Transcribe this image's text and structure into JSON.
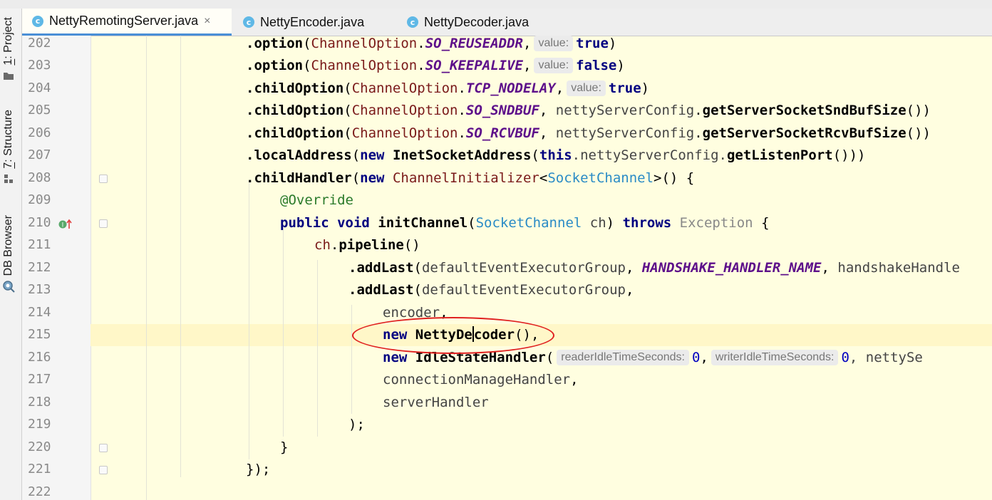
{
  "tool_windows": [
    {
      "number": "1",
      "label": "Project"
    },
    {
      "number": "7",
      "label": "Structure"
    },
    {
      "label": "DB Browser"
    }
  ],
  "editor_tabs": [
    {
      "label": "NettyRemotingServer.java",
      "active": true,
      "closable": true
    },
    {
      "label": "NettyEncoder.java",
      "active": false
    },
    {
      "label": "NettyDecoder.java",
      "active": false
    }
  ],
  "file_icon_letter": "c",
  "close_glyph": "×",
  "line_numbers": [
    "202",
    "203",
    "204",
    "205",
    "206",
    "207",
    "208",
    "209",
    "210",
    "211",
    "212",
    "213",
    "214",
    "215",
    "216",
    "217",
    "218",
    "219",
    "220",
    "221",
    "222"
  ],
  "code": {
    "l202": {
      "dot_option": ".option",
      "open": "(",
      "type": "ChannelOption",
      "dot": ".",
      "const": "SO_REUSEADDR",
      "comma": ",",
      "hint": "value:",
      "val": "true",
      "close": ")"
    },
    "l203": {
      "dot_option": ".option",
      "open": "(",
      "type": "ChannelOption",
      "dot": ".",
      "const": "SO_KEEPALIVE",
      "comma": ",",
      "hint": "value:",
      "val": "false",
      "close": ")"
    },
    "l204": {
      "dot_option": ".childOption",
      "open": "(",
      "type": "ChannelOption",
      "dot": ".",
      "const": "TCP_NODELAY",
      "comma": ",",
      "hint": "value:",
      "val": "true",
      "close": ")"
    },
    "l205": {
      "dot_option": ".childOption",
      "open": "(",
      "type": "ChannelOption",
      "dot": ".",
      "const": "SO_SNDBUF",
      "comma": ", ",
      "field": "nettyServerConfig",
      "dot2": ".",
      "call": "getServerSocketSndBufSize",
      "close": "())"
    },
    "l206": {
      "dot_option": ".childOption",
      "open": "(",
      "type": "ChannelOption",
      "dot": ".",
      "const": "SO_RCVBUF",
      "comma": ", ",
      "field": "nettyServerConfig",
      "dot2": ".",
      "call": "getServerSocketRcvBufSize",
      "close": "())"
    },
    "l207": {
      "call": ".localAddress",
      "open": "(",
      "kw_new": "new",
      "cls": "InetSocketAddress",
      "open2": "(",
      "kw_this": "this",
      "field": ".nettyServerConfig.",
      "call2": "getListenPort",
      "close": "()))"
    },
    "l208": {
      "call": ".childHandler",
      "open": "(",
      "kw_new": "new",
      "cls": "ChannelInitializer",
      "lt": "<",
      "tp": "SocketChannel",
      "rest": ">() {"
    },
    "l209": {
      "ann": "@Override"
    },
    "l210": {
      "kw1": "public",
      "kw2": "void",
      "name": "initChannel",
      "open": "(",
      "tp": "SocketChannel",
      "param": "ch",
      "close": ")",
      "kw3": "throws",
      "ex": "Exception",
      "brace": "{"
    },
    "l211": {
      "var": "ch",
      "dot": ".",
      "call": "pipeline",
      "close": "()"
    },
    "l212": {
      "call": ".addLast",
      "open": "(",
      "arg": "defaultEventExecutorGroup",
      "comma": ", ",
      "const": "HANDSHAKE_HANDLER_NAME",
      "comma2": ", ",
      "arg2": "handshakeHandle"
    },
    "l213": {
      "call": ".addLast",
      "open": "(",
      "arg": "defaultEventExecutorGroup",
      "comma": ","
    },
    "l214": {
      "arg": "encoder",
      "comma": ","
    },
    "l215": {
      "kw_new": "new",
      "cls_a": "NettyDe",
      "cls_b": "coder",
      "rest": "(),"
    },
    "l216": {
      "kw_new": "new",
      "cls": "IdleStateHandler",
      "open": "(",
      "hint1": "readerIdleTimeSeconds:",
      "v1": "0",
      "comma": ",",
      "hint2": "writerIdleTimeSeconds:",
      "v2": "0",
      "rest": ", nettySe"
    },
    "l217": {
      "arg": "connectionManageHandler",
      "comma": ","
    },
    "l218": {
      "arg": "serverHandler"
    },
    "l219": {
      "text": ");"
    },
    "l220": {
      "text": "}"
    },
    "l221": {
      "text": "});"
    }
  },
  "colors": {
    "annotation_ring": "#e02020",
    "active_tab_underline": "#4a8fd6",
    "keyword": "#000080",
    "constant": "#5d0f8a"
  }
}
